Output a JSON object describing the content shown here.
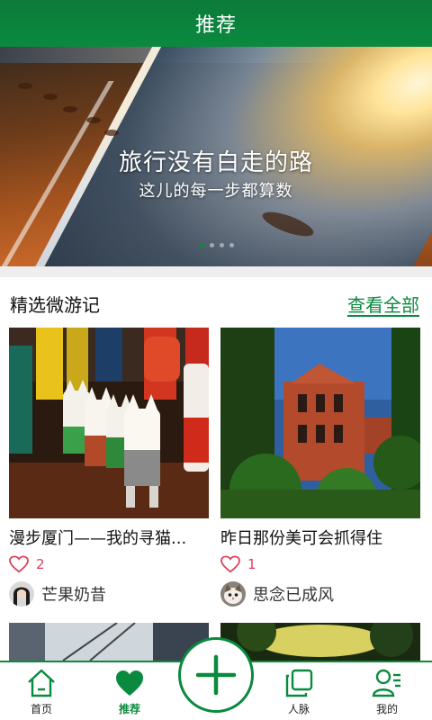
{
  "header": {
    "title": "推荐"
  },
  "banner": {
    "title": "旅行没有白走的路",
    "subtitle": "这儿的每一步都算数",
    "dots": 4,
    "active_dot": 0
  },
  "section": {
    "title": "精选微游记",
    "see_all": "查看全部"
  },
  "cards": [
    {
      "title": "漫步厦门——我的寻猫...",
      "likes": "2",
      "author": "芒果奶昔",
      "image_icon": "cat-figurines-photo",
      "avatar_icon": "user-avatar-dark-hair"
    },
    {
      "title": "昨日那份美可会抓得住",
      "likes": "1",
      "author": "思念已成风",
      "image_icon": "red-building-trees-photo",
      "avatar_icon": "user-avatar-cat"
    }
  ],
  "bottom_nav": {
    "items": [
      {
        "label": "首页",
        "icon": "home-icon"
      },
      {
        "label": "推荐",
        "icon": "heart-icon",
        "active": true
      },
      {
        "label": "人脉",
        "icon": "contacts-icon"
      },
      {
        "label": "我的",
        "icon": "profile-icon"
      }
    ],
    "publish_icon": "plus-icon"
  },
  "colors": {
    "brand": "#0a8a3f",
    "heart": "#e0405a"
  }
}
